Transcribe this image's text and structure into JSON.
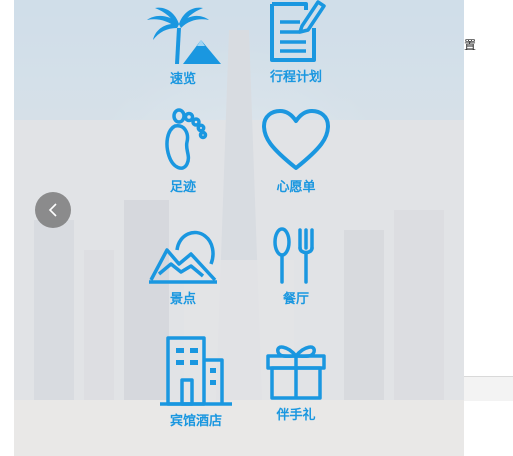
{
  "background_fragment": {
    "text": "置"
  },
  "back_button": {
    "icon": "chevron-left-icon"
  },
  "menu": {
    "items": [
      {
        "label": "速览",
        "icon": "palm-island-icon"
      },
      {
        "label": "行程计划",
        "icon": "notepad-pencil-icon"
      },
      {
        "label": "足迹",
        "icon": "footprint-icon"
      },
      {
        "label": "心愿单",
        "icon": "heart-icon"
      },
      {
        "label": "景点",
        "icon": "mountain-icon"
      },
      {
        "label": "餐厅",
        "icon": "spoon-fork-icon"
      },
      {
        "label": "宾馆酒店",
        "icon": "building-icon"
      },
      {
        "label": "伴手礼",
        "icon": "gift-icon"
      }
    ]
  },
  "colors": {
    "accent": "#1a97e0",
    "overlay": "#ffffff"
  }
}
